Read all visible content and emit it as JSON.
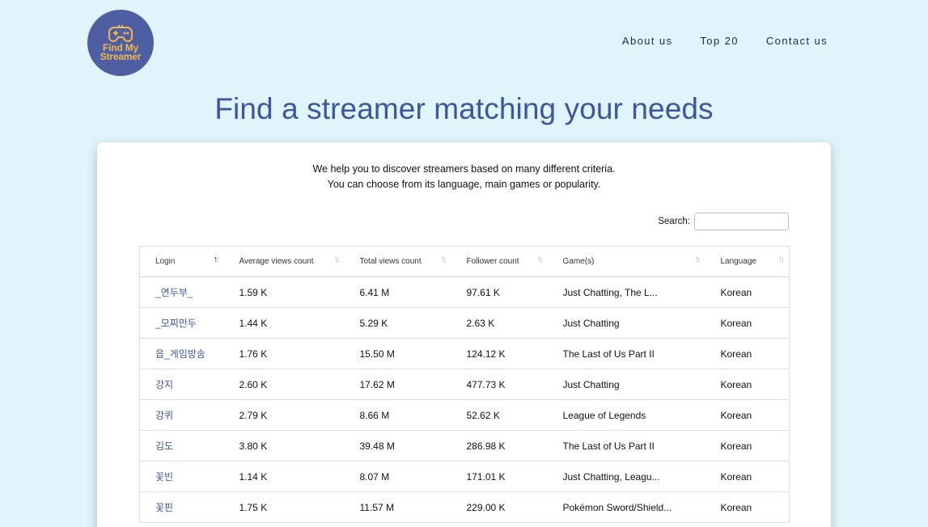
{
  "logo": {
    "line1": "Find My",
    "line2": "Streamer"
  },
  "nav": [
    {
      "label": "About us"
    },
    {
      "label": "Top 20"
    },
    {
      "label": "Contact us"
    }
  ],
  "hero": {
    "title": "Find a streamer matching your needs"
  },
  "intro": {
    "line1": "We help you to discover streamers based on many different criteria.",
    "line2": "You can choose from its language, main games or popularity."
  },
  "search": {
    "label": "Search:",
    "value": ""
  },
  "table": {
    "columns": [
      {
        "label": "Login",
        "sorted": "asc"
      },
      {
        "label": "Average views count"
      },
      {
        "label": "Total views count"
      },
      {
        "label": "Follower count"
      },
      {
        "label": "Game(s)"
      },
      {
        "label": "Language"
      }
    ],
    "rows": [
      {
        "login": "_연두부_",
        "avg": "1.59 K",
        "total": "6.41 M",
        "followers": "97.61 K",
        "games": "Just Chatting, The L...",
        "language": "Korean"
      },
      {
        "login": "_모찌만두",
        "avg": "1.44 K",
        "total": "5.29 K",
        "followers": "2.63 K",
        "games": "Just Chatting",
        "language": "Korean"
      },
      {
        "login": "읍_게임방송",
        "avg": "1.76 K",
        "total": "15.50 M",
        "followers": "124.12 K",
        "games": "The Last of Us Part II",
        "language": "Korean"
      },
      {
        "login": "강지",
        "avg": "2.60 K",
        "total": "17.62 M",
        "followers": "477.73 K",
        "games": "Just Chatting",
        "language": "Korean"
      },
      {
        "login": "강퀴",
        "avg": "2.79 K",
        "total": "8.66 M",
        "followers": "52.62 K",
        "games": "League of Legends",
        "language": "Korean"
      },
      {
        "login": "김도",
        "avg": "3.80 K",
        "total": "39.48 M",
        "followers": "286.98 K",
        "games": "The Last of Us Part II",
        "language": "Korean"
      },
      {
        "login": "꽃빈",
        "avg": "1.14 K",
        "total": "8.07 M",
        "followers": "171.01 K",
        "games": "Just Chatting, Leagu...",
        "language": "Korean"
      },
      {
        "login": "꽃핀",
        "avg": "1.75 K",
        "total": "11.57 M",
        "followers": "229.00 K",
        "games": "Pokémon Sword/Shield...",
        "language": "Korean"
      }
    ]
  },
  "colors": {
    "background": "#e0f4fb",
    "brand": "#4d5ea3",
    "accent": "#f2b64c",
    "title": "#3e56a0"
  },
  "icons": {
    "logo": "gamepad-icon",
    "sort": "sort-arrows-icon"
  }
}
